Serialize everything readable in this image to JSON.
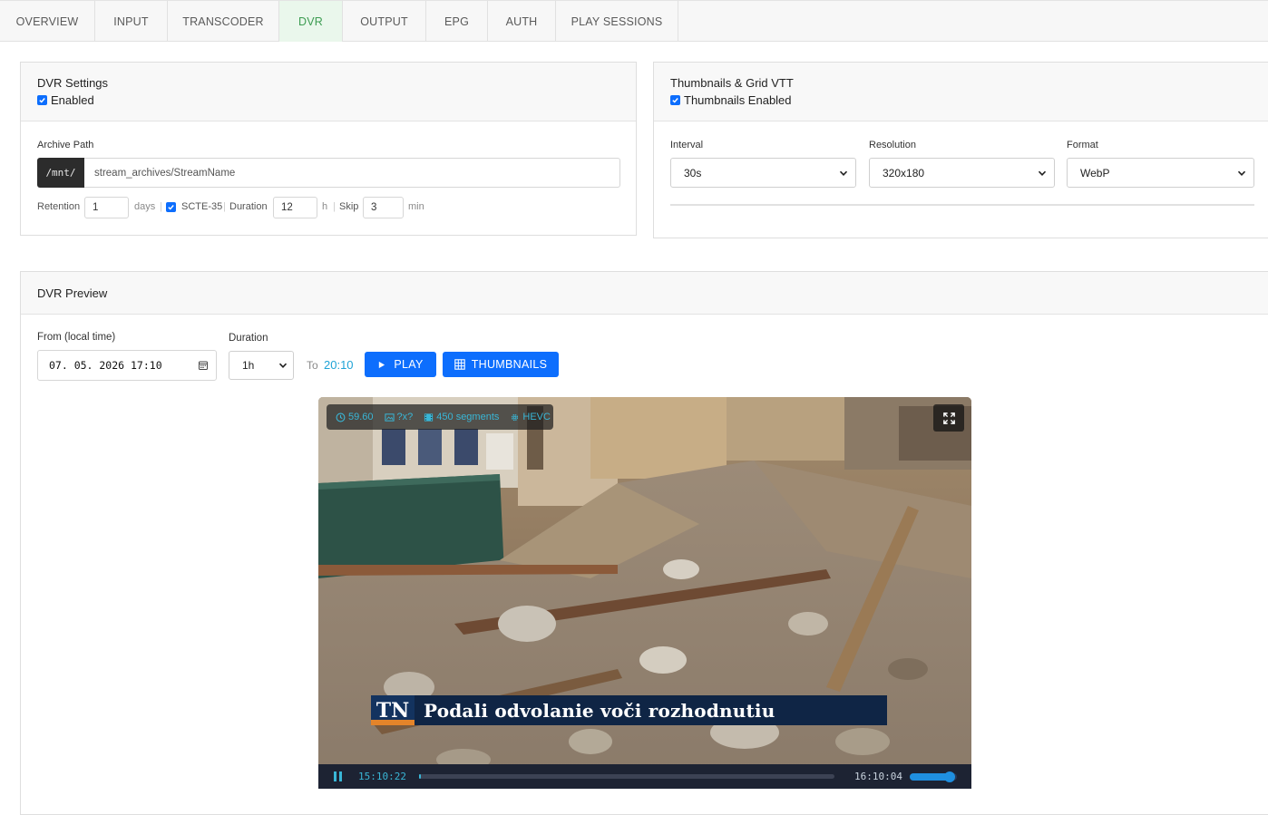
{
  "tabs": [
    {
      "label": "OVERVIEW"
    },
    {
      "label": "INPUT"
    },
    {
      "label": "TRANSCODER"
    },
    {
      "label": "DVR",
      "active": true
    },
    {
      "label": "OUTPUT"
    },
    {
      "label": "EPG"
    },
    {
      "label": "AUTH"
    },
    {
      "label": "PLAY SESSIONS"
    }
  ],
  "dvr_settings": {
    "title": "DVR Settings",
    "enabled_label": "Enabled",
    "enabled": true,
    "archive_path_label": "Archive Path",
    "path_prefix": "/mnt/",
    "path_value": "stream_archives/StreamName",
    "retention_label": "Retention",
    "retention_value": "1",
    "retention_unit": "days",
    "scte_label": "SCTE-35",
    "scte_checked": true,
    "duration_label": "Duration",
    "duration_value": "12",
    "duration_unit": "h",
    "skip_label": "Skip",
    "skip_value": "3",
    "skip_unit": "min",
    "sep": "|"
  },
  "thumbnails": {
    "title": "Thumbnails & Grid VTT",
    "enabled_label": "Thumbnails Enabled",
    "enabled": true,
    "interval_label": "Interval",
    "interval_value": "30s",
    "resolution_label": "Resolution",
    "resolution_value": "320x180",
    "format_label": "Format",
    "format_value": "WebP"
  },
  "preview": {
    "title": "DVR Preview",
    "from_label": "From (local time)",
    "from_value": "07. 05. 2026 17:10",
    "duration_label": "Duration",
    "duration_value": "1h",
    "to_label": "To",
    "to_value": "20:10",
    "play_label": "PLAY",
    "thumbnails_label": "THUMBNAILS"
  },
  "player": {
    "fps": "59.60",
    "resolution": "?x?",
    "segments": "450 segments",
    "codec": "HEVC",
    "logo_text": "TN",
    "headline": "Podali odvolanie voči rozhodnutiu",
    "current_time": "15:10:22",
    "end_time": "16:10:04",
    "progress": 0.004,
    "volume": 0.85
  },
  "colors": {
    "accent": "#0d6efd",
    "tab_active_text": "#3d9c52",
    "tab_active_bg": "#eaf7ec",
    "to_time": "#1fa3d6",
    "overlay_text": "#39b6d6",
    "player_bar": "#1d2333"
  }
}
